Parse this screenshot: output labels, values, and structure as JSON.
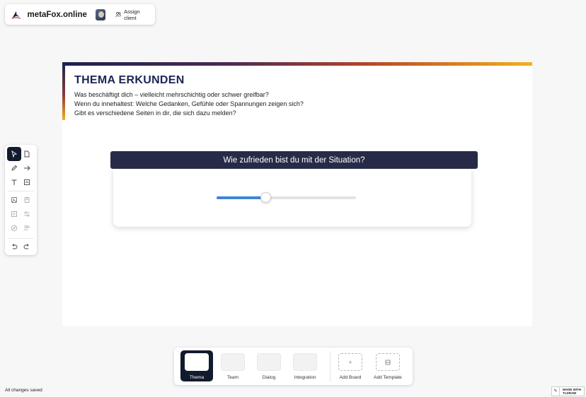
{
  "topbar": {
    "brand": "metaFox.online",
    "assign_label": "Assign client"
  },
  "board": {
    "title": "THEMA ERKUNDEN",
    "lines": [
      "Was beschäftigt dich – vielleicht mehrschichtig oder schwer greifbar?",
      "Wenn du innehaltest: Welche Gedanken, Gefühle oder Spannungen zeigen sich?",
      "Gibt es verschiedene Seiten in dir, die sich dazu melden?"
    ]
  },
  "question": {
    "text": "Wie zufrieden bist du mit der Situation?",
    "slider_value_fraction": 0.35
  },
  "pages": [
    {
      "label": "Thema",
      "active": true
    },
    {
      "label": "Team",
      "active": false
    },
    {
      "label": "Dialog",
      "active": false
    },
    {
      "label": "Integration",
      "active": false
    }
  ],
  "actions": {
    "add_board": "Add Board",
    "add_template": "Add Template"
  },
  "status": {
    "saved": "All changes saved"
  },
  "badge": {
    "line1": "MADE WITH",
    "line2": "TLDRAW"
  },
  "colors": {
    "accent_dark": "#121a2e",
    "question_header": "#272b48",
    "slider_fill": "#3f86d6",
    "title": "#1b2556"
  },
  "tools": [
    "select-icon",
    "page-icon",
    "pencil-icon",
    "arrow-icon",
    "text-icon",
    "image-frame-icon",
    "media-icon",
    "card-icon",
    "note-icon",
    "sliders-icon",
    "compass-icon",
    "users-icon",
    "undo-icon",
    "redo-icon"
  ]
}
